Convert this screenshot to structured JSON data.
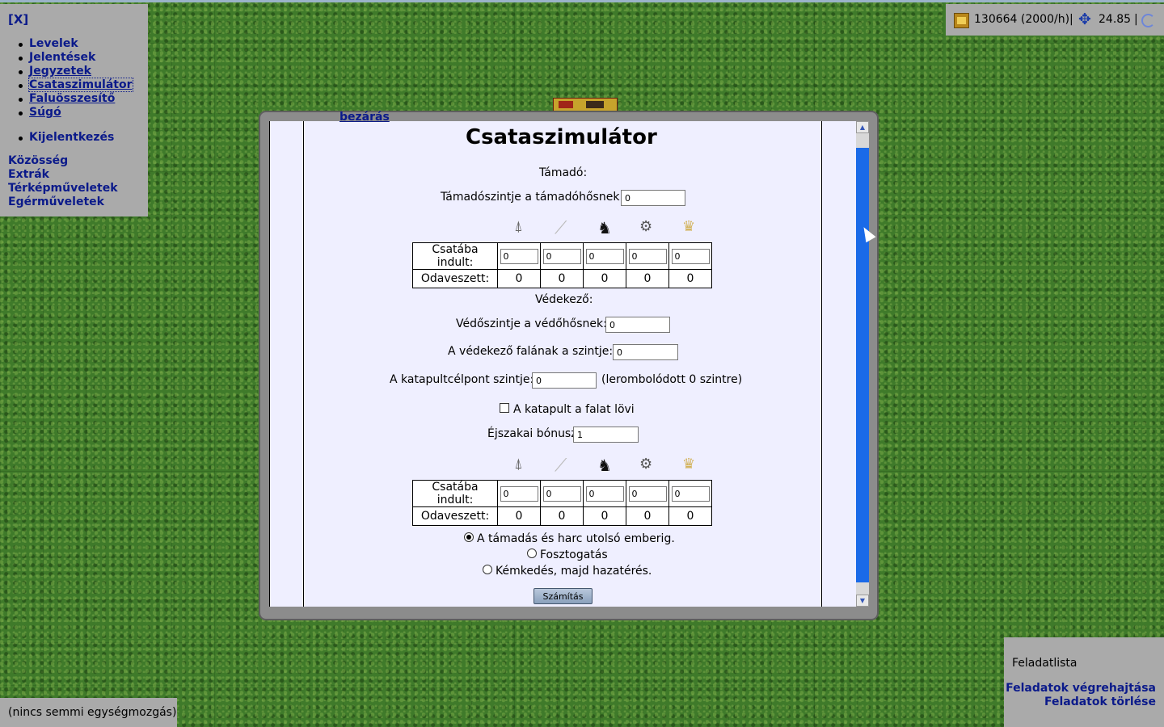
{
  "menu": {
    "close": "[X]",
    "items": [
      "Levelek",
      "Jelentések",
      "Jegyzetek",
      "Csataszimulátor",
      "Faluösszesítő",
      "Súgó"
    ],
    "logout": "Kijelentkezés",
    "extra": [
      "Közösség",
      "Extrák",
      "Térképműveletek",
      "Egérműveletek"
    ]
  },
  "resources": {
    "gold": "130664 (2000/h)",
    "separator": "|",
    "points": "24.85",
    "gold_icon": "gold-chest-icon",
    "points_icon": "compass-star-icon",
    "refresh_icon": "refresh-icon"
  },
  "dialog": {
    "close": "bezárás",
    "title": "Csataszimulátor",
    "attacker": {
      "heading": "Támadó:",
      "hero_label": "Támadószintje a támadóhősnek:",
      "hero_value": "0",
      "row_sent": "Csatába indult:",
      "row_lost": "Odaveszett:",
      "sent": [
        "0",
        "0",
        "0",
        "0",
        "0"
      ],
      "lost": [
        "0",
        "0",
        "0",
        "0",
        "0"
      ]
    },
    "defender": {
      "heading": "Védekező:",
      "hero_label": "Védőszintje a védőhősnek:",
      "hero_value": "0",
      "wall_label": "A védekező falának a szintje:",
      "wall_value": "0",
      "catapult_label": "A katapultcélpont szintje:",
      "catapult_value": "0",
      "catapult_note": "(lerombolódott 0 szintre)",
      "wall_checkbox": "A katapult a falat lövi",
      "night_label": "Éjszakai bónusz",
      "night_value": "1",
      "row_sent": "Csatába indult:",
      "row_lost": "Odaveszett:",
      "sent": [
        "0",
        "0",
        "0",
        "0",
        "0"
      ],
      "lost": [
        "0",
        "0",
        "0",
        "0",
        "0"
      ]
    },
    "units": [
      "spear-icon",
      "sword-icon",
      "horse-icon",
      "catapult-icon",
      "crown-icon"
    ],
    "modes": [
      "A támadás és harc utolsó emberig.",
      "Fosztogatás",
      "Kémkedés, majd hazatérés."
    ],
    "selected_mode": 0,
    "calc_button": "Számítás"
  },
  "tasks": {
    "title": "Feladatlista",
    "run": "Feladatok végrehajtása",
    "clear": "Feladatok törlése"
  },
  "status": "(nincs semmi egységmozgás)"
}
